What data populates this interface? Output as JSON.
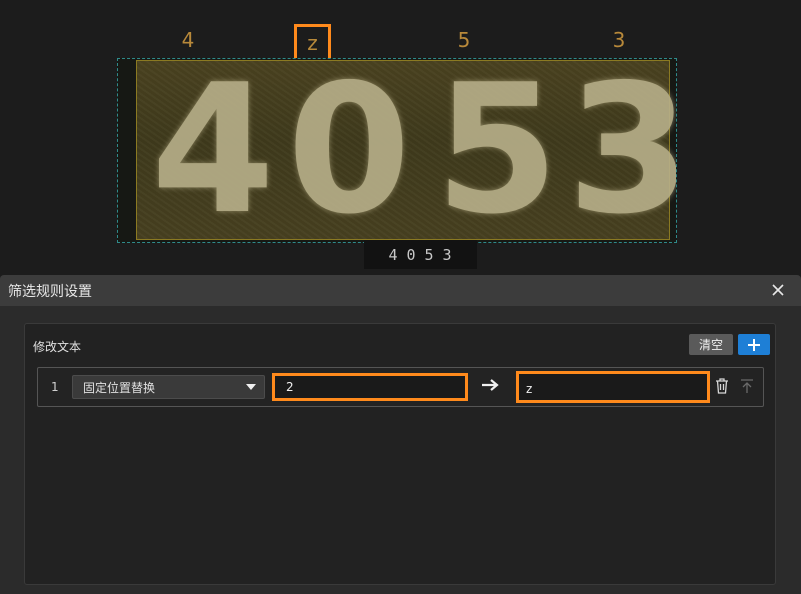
{
  "preview": {
    "char_labels": [
      "4",
      "z",
      "5",
      "3"
    ],
    "digits": [
      "4",
      "0",
      "5",
      "3"
    ],
    "ocr_result": "4053",
    "highlight_color": "#ff8a1c",
    "label_color": "#b8893a"
  },
  "dialog": {
    "title": "筛选规则设置",
    "close_icon": "close-icon",
    "section_title": "修改文本",
    "clear_label": "清空",
    "add_icon": "plus-icon",
    "rules": [
      {
        "index": "1",
        "mode": "固定位置替换",
        "source": "2",
        "target": "z"
      }
    ],
    "accent_color": "#1e7fd6"
  }
}
